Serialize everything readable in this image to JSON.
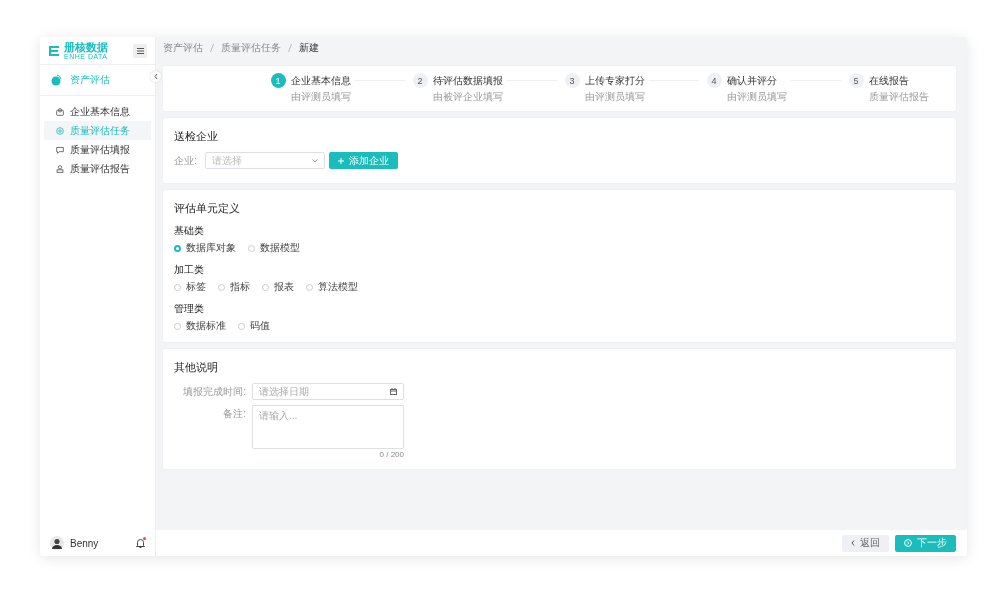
{
  "logo": {
    "title": "册核数据",
    "subtitle": "ENHE DATA"
  },
  "sidebar": {
    "section": "资产评估",
    "items": [
      {
        "label": "企业基本信息",
        "selected": false
      },
      {
        "label": "质量评估任务",
        "selected": true
      },
      {
        "label": "质量评估填报",
        "selected": false
      },
      {
        "label": "质量评估报告",
        "selected": false
      }
    ],
    "user": {
      "name": "Benny",
      "unread": true
    }
  },
  "breadcrumb": [
    "资产评估",
    "质量评估任务",
    "新建"
  ],
  "steps": [
    {
      "number": "1",
      "title": "企业基本信息",
      "subtitle": "由评测员填写",
      "selected": true
    },
    {
      "number": "2",
      "title": "待评估数据填报",
      "subtitle": "由被评企业填写",
      "selected": false
    },
    {
      "number": "3",
      "title": "上传专家打分",
      "subtitle": "由评测员填写",
      "selected": false
    },
    {
      "number": "4",
      "title": "确认并评分",
      "subtitle": "由评测员填写",
      "selected": false
    },
    {
      "number": "5",
      "title": "在线报告",
      "subtitle": "质量评估报告",
      "selected": false
    }
  ],
  "company_card": {
    "title": "送检企业",
    "label": "企业:",
    "placeholder": "请选择",
    "add_button": "添加企业"
  },
  "unit_card": {
    "title": "评估单元定义",
    "groups": [
      {
        "label": "基础类",
        "options": [
          {
            "label": "数据库对象",
            "selected": true
          },
          {
            "label": "数据模型",
            "selected": false
          }
        ]
      },
      {
        "label": "加工类",
        "options": [
          {
            "label": "标签",
            "selected": false
          },
          {
            "label": "指标",
            "selected": false
          },
          {
            "label": "报表",
            "selected": false
          },
          {
            "label": "算法模型",
            "selected": false
          }
        ]
      },
      {
        "label": "管理类",
        "options": [
          {
            "label": "数据标准",
            "selected": false
          },
          {
            "label": "码值",
            "selected": false
          }
        ]
      }
    ]
  },
  "notes_card": {
    "title": "其他说明",
    "date_label": "填报完成时间:",
    "date_placeholder": "请选择日期",
    "remark_label": "备注:",
    "remark_placeholder": "请输入...",
    "counter": "0 / 200"
  },
  "footer": {
    "back": "返回",
    "next": "下一步"
  }
}
